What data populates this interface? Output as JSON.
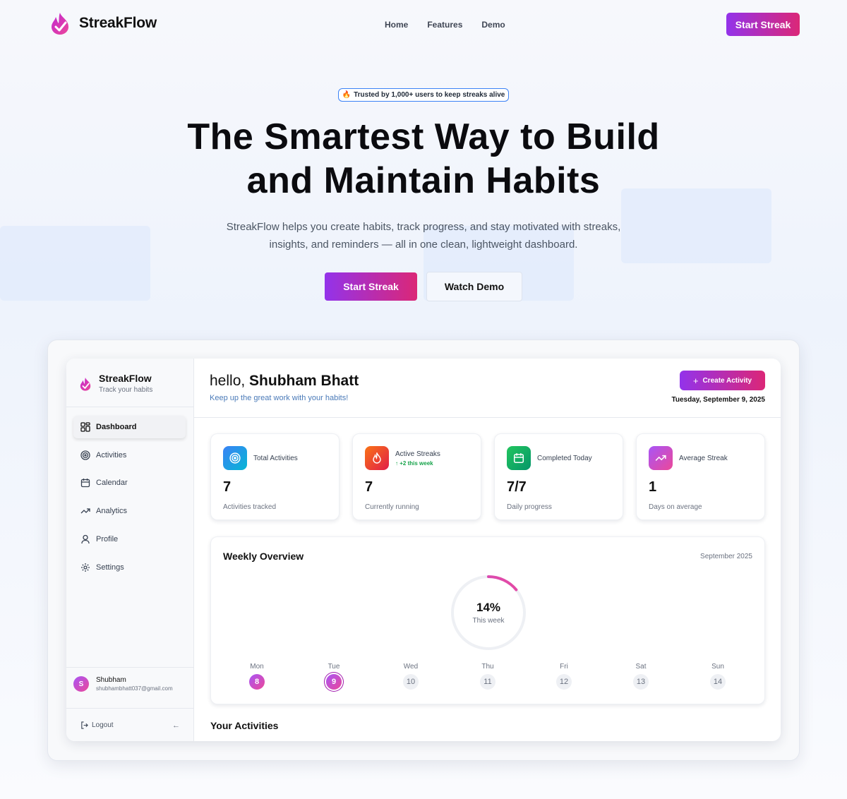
{
  "nav": {
    "brand": "StreakFlow",
    "links": [
      "Home",
      "Features",
      "Demo"
    ],
    "cta": "Start Streak"
  },
  "hero": {
    "badge_icon": "fire-emoji",
    "badge": "Trusted by 1,000+ users to keep streaks alive",
    "title_line1": "The Smartest Way to Build",
    "title_line2": "and Maintain Habits",
    "subtitle": "StreakFlow helps you create habits, track progress, and stay motivated with streaks, insights, and reminders — all in one clean, lightweight dashboard.",
    "primary_cta": "Start Streak",
    "secondary_cta": "Watch Demo"
  },
  "dashboard": {
    "sidebar": {
      "brand": "StreakFlow",
      "tagline": "Track your habits",
      "items": [
        {
          "label": "Dashboard",
          "icon": "grid-icon",
          "active": true
        },
        {
          "label": "Activities",
          "icon": "target-icon"
        },
        {
          "label": "Calendar",
          "icon": "calendar-icon"
        },
        {
          "label": "Analytics",
          "icon": "trend-icon"
        },
        {
          "label": "Profile",
          "icon": "user-icon"
        },
        {
          "label": "Settings",
          "icon": "gear-icon"
        }
      ],
      "user": {
        "initial": "S",
        "name": "Shubham",
        "email": "shubhambhatt037@gmail.com"
      },
      "logout": "Logout",
      "back_icon": "arrow-left-icon"
    },
    "header": {
      "greeting": "hello,",
      "name": "Shubham Bhatt",
      "subtitle": "Keep up the great work with your habits!",
      "create_button": "Create Activity",
      "date": "Tuesday, September 9, 2025"
    },
    "stats": [
      {
        "label": "Total Activities",
        "value": "7",
        "sub": "Activities tracked",
        "icon": "target-icon",
        "color": "#2f80ed"
      },
      {
        "label": "Active Streaks",
        "trend": "+2 this week",
        "value": "7",
        "sub": "Currently running",
        "icon": "flame-icon",
        "color": "#f05a28"
      },
      {
        "label": "Completed Today",
        "value": "7/7",
        "sub": "Daily progress",
        "icon": "calendar-icon",
        "color": "#16b364"
      },
      {
        "label": "Average Streak",
        "value": "1",
        "sub": "Days on average",
        "icon": "trend-icon",
        "color": "#d946ef"
      }
    ],
    "weekly": {
      "title": "Weekly Overview",
      "month": "September 2025",
      "percent": "14%",
      "percent_value": 14,
      "percent_label": "This week",
      "days": [
        {
          "name": "Mon",
          "date": "8",
          "state": "done"
        },
        {
          "name": "Tue",
          "date": "9",
          "state": "today"
        },
        {
          "name": "Wed",
          "date": "10",
          "state": ""
        },
        {
          "name": "Thu",
          "date": "11",
          "state": ""
        },
        {
          "name": "Fri",
          "date": "12",
          "state": ""
        },
        {
          "name": "Sat",
          "date": "13",
          "state": ""
        },
        {
          "name": "Sun",
          "date": "14",
          "state": ""
        }
      ]
    },
    "activities_title": "Your Activities"
  },
  "colors": {
    "accent_start": "#9333ea",
    "accent_end": "#db2777"
  }
}
